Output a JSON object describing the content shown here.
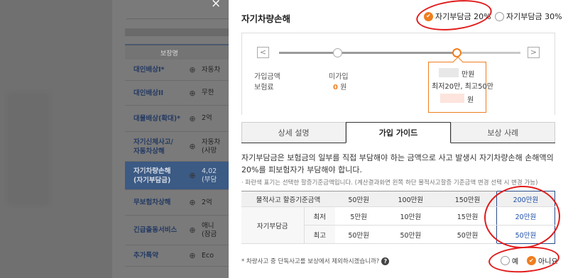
{
  "background": {
    "column_header": "보장명",
    "rows": [
      {
        "name": "대인배상I*",
        "value": "자동차"
      },
      {
        "name": "대인배상II",
        "value": "무한"
      },
      {
        "name": "대물배상(확대)*",
        "value": "2억"
      },
      {
        "name": "자기신체사고/\n자동차상해",
        "value": "자동차\n(사망"
      },
      {
        "name": "자기차량손해\n(자기부담금)",
        "value": "4,02\n(부담"
      },
      {
        "name": "무보험차상해",
        "value": "2억"
      },
      {
        "name": "긴급출동서비스",
        "value": "애니\n(잠금"
      },
      {
        "name": "추가특약",
        "value": "Eco"
      }
    ],
    "plus_symbol": "⊕"
  },
  "modal": {
    "close_symbol": "×",
    "title": "자기차량손해",
    "options": {
      "opt20_label": "자기부담금 20%",
      "opt30_label": "자기부담금 30%",
      "selected": "opt20"
    },
    "slider": {
      "left_arrow": "<",
      "right_arrow": ">",
      "label_join_amount": "가입금액",
      "label_premium": "보험료",
      "unjoined_label": "미가입",
      "unjoined_premium_value": "0",
      "won_unit": "원",
      "selected_amount_suffix": "만원",
      "selected_range": "최저20만, 최고50만",
      "selected_won": "원",
      "position_fraction": 0.74
    },
    "tabs": [
      "상세 설명",
      "가입 가이드",
      "보상 사례"
    ],
    "active_tab": 1,
    "description": "자기부담금은 보험금의 일부를 직접 부담해야 하는 금액으로 사고 발생시 자기차량손해 손해액의 20%를 피보험자가 부담해야 합니다.",
    "note": "· 파란색 표기는 선택한 할증기준금액입니다. (계산결과화면 왼쪽 하단 물적사고할증 기준금액 변경 선택 시 변경 가능)",
    "table": {
      "header_label": "물적사고 할증기준금액",
      "columns": [
        "50만원",
        "100만원",
        "150만원",
        "200만원"
      ],
      "row_group_label": "자기부담금",
      "rows": [
        {
          "label": "최저",
          "values": [
            "5만원",
            "10만원",
            "15만원",
            "20만원"
          ]
        },
        {
          "label": "최고",
          "values": [
            "50만원",
            "50만원",
            "50만원",
            "50만원"
          ]
        }
      ],
      "selected_column": 3
    },
    "question": "* 차량사고 중 단독사고를 보상에서 제외하시겠습니까?",
    "question_icon": "?",
    "yes_label": "예",
    "no_label": "아니요",
    "yn_selected": "no"
  },
  "colors": {
    "accent_orange": "#f07d1e",
    "navy": "#2a4d8a",
    "annotation_red": "#e11b1b"
  }
}
